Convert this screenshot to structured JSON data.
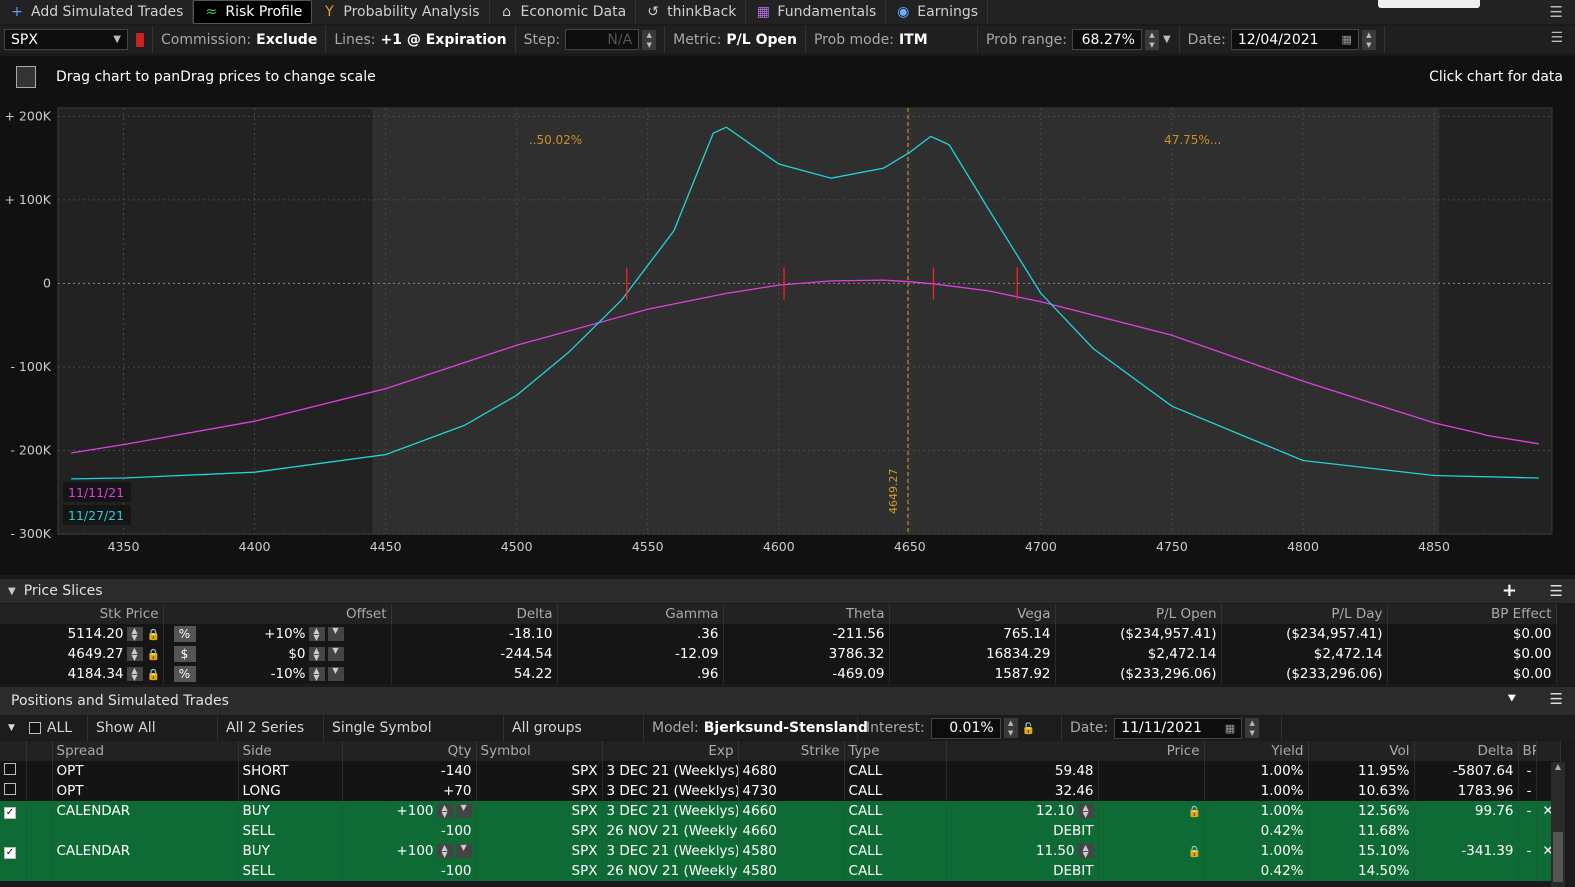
{
  "tabs": [
    {
      "icon": "plus-icon",
      "glyph": "+",
      "label": "Add Simulated Trades",
      "active": false
    },
    {
      "icon": "risk-profile-icon",
      "glyph": "≈",
      "label": "Risk Profile",
      "active": true
    },
    {
      "icon": "probability-icon",
      "glyph": "Y",
      "label": "Probability Analysis",
      "active": false
    },
    {
      "icon": "economic-data-icon",
      "glyph": "⌂",
      "label": "Economic Data",
      "active": false
    },
    {
      "icon": "thinkback-icon",
      "glyph": "↺",
      "label": "thinkBack",
      "active": false
    },
    {
      "icon": "fundamentals-icon",
      "glyph": "▦",
      "label": "Fundamentals",
      "active": false
    },
    {
      "icon": "earnings-icon",
      "glyph": "◉",
      "label": "Earnings",
      "active": false
    }
  ],
  "controls": {
    "symbol": "SPX",
    "commission_label": "Commission:",
    "commission_value": "Exclude",
    "lines_label": "Lines:",
    "lines_value": "+1 @ Expiration",
    "step_label": "Step:",
    "step_value": "N/A",
    "metric_label": "Metric:",
    "metric_value": "P/L Open",
    "probmode_label": "Prob mode:",
    "probmode_value": "ITM",
    "probrange_label": "Prob range:",
    "probrange_value": "68.27%",
    "date_label": "Date:",
    "date_value": "12/04/2021"
  },
  "chart_header": {
    "hint": "Drag chart to panDrag prices to change scale",
    "click_hint": "Click chart for data"
  },
  "chart_data": {
    "type": "line",
    "xlim": [
      4325,
      4895
    ],
    "ylim": [
      -300000,
      210000
    ],
    "xticks": [
      "4350",
      "4400",
      "4450",
      "4500",
      "4550",
      "4600",
      "4650",
      "4700",
      "4750",
      "4800",
      "4850"
    ],
    "yticks": [
      "+ 200K",
      "+ 100K",
      "0",
      "- 100K",
      "- 200K",
      "- 300K"
    ],
    "prob_left_label": "..50.02%",
    "prob_right_label": "47.75%...",
    "current_price_label": "4649.27",
    "current_price": 4649.27,
    "shaded_range": [
      4445,
      4852
    ],
    "colors": {
      "series1": "#e040e0",
      "series2": "#22d3d8",
      "current": "#d4a020",
      "marker": "#ff2020"
    },
    "series": [
      {
        "name": "11/11/21",
        "x": [
          4330,
          4350,
          4400,
          4450,
          4500,
          4550,
          4580,
          4600,
          4620,
          4640,
          4650,
          4660,
          4680,
          4700,
          4750,
          4800,
          4850,
          4868,
          4870,
          4890
        ],
        "y": [
          -203000,
          -193000,
          -165000,
          -126000,
          -74000,
          -31000,
          -12000,
          -2000,
          3000,
          4000,
          2000,
          -1000,
          -9000,
          -22000,
          -62000,
          -117000,
          -167000,
          -180000,
          -182000,
          -192000
        ]
      },
      {
        "name": "11/27/21",
        "x": [
          4330,
          4350,
          4400,
          4450,
          4480,
          4500,
          4520,
          4540,
          4560,
          4575,
          4580,
          4600,
          4620,
          4640,
          4650,
          4658,
          4665,
          4680,
          4700,
          4720,
          4750,
          4800,
          4850,
          4890
        ],
        "y": [
          -234000,
          -233000,
          -226000,
          -205000,
          -170000,
          -134000,
          -82000,
          -20000,
          63000,
          180000,
          187000,
          143000,
          126000,
          138000,
          157000,
          176000,
          166000,
          89000,
          -12000,
          -78000,
          -147000,
          -212000,
          -230000,
          -233000
        ]
      }
    ],
    "markers_x": [
      4542,
      4602,
      4659,
      4691
    ]
  },
  "price_slices": {
    "title": "Price Slices",
    "headers": [
      "Stk Price",
      "Offset",
      "Delta",
      "Gamma",
      "Theta",
      "Vega",
      "P/L Open",
      "P/L Day",
      "BP Effect"
    ],
    "rows": [
      {
        "stk": "5114.20",
        "unit": "%",
        "offset": "+10%",
        "delta": "-18.10",
        "gamma": ".36",
        "theta": "-211.56",
        "vega": "765.14",
        "plopen": "($234,957.41)",
        "plday": "($234,957.41)",
        "bp": "$0.00"
      },
      {
        "stk": "4649.27",
        "unit": "$",
        "offset": "$0",
        "delta": "-244.54",
        "gamma": "-12.09",
        "theta": "3786.32",
        "vega": "16834.29",
        "plopen": "$2,472.14",
        "plday": "$2,472.14",
        "bp": "$0.00"
      },
      {
        "stk": "4184.34",
        "unit": "%",
        "offset": "-10%",
        "delta": "54.22",
        "gamma": ".96",
        "theta": "-469.09",
        "vega": "1587.92",
        "plopen": "($233,296.06)",
        "plday": "($233,296.06)",
        "bp": "$0.00"
      }
    ]
  },
  "positions": {
    "title": "Positions and Simulated Trades",
    "all_label": "ALL",
    "show": "Show All",
    "series": "All 2 Series",
    "symbol_mode": "Single Symbol",
    "groups": "All groups",
    "model_label": "Model:",
    "model_value": "Bjerksund-Stensland",
    "interest_label": "Interest:",
    "interest_value": "0.01%",
    "date_label": "Date:",
    "date_value": "11/11/2021",
    "headers": [
      "Spread",
      "Side",
      "Qty",
      "Symbol",
      "Exp",
      "Strike",
      "Type",
      "Price",
      "Yield",
      "Vol",
      "Delta",
      "BP Effect"
    ],
    "rows": [
      {
        "green": false,
        "check": true,
        "spread": "OPT",
        "side": "SHORT",
        "qty": "-140",
        "symbol": "SPX",
        "exp": "3 DEC 21 (Weeklys)",
        "strike": "4680",
        "type": "CALL",
        "price": "59.48",
        "yield": "1.00%",
        "vol": "11.95%",
        "delta": "-5807.64",
        "bp": "-"
      },
      {
        "green": false,
        "check": true,
        "spread": "OPT",
        "side": "LONG",
        "qty": "+70",
        "symbol": "SPX",
        "exp": "3 DEC 21 (Weeklys)",
        "strike": "4730",
        "type": "CALL",
        "price": "32.46",
        "yield": "1.00%",
        "vol": "10.63%",
        "delta": "1783.96",
        "bp": "-"
      },
      {
        "green": true,
        "check": true,
        "checked": true,
        "spread": "CALENDAR",
        "side": "BUY",
        "qty": "+100",
        "symbol": "SPX",
        "exp": "3 DEC 21 (Weeklys)",
        "strike": "4660",
        "type": "CALL",
        "price": "12.10",
        "yield": "1.00%",
        "vol": "12.56%",
        "delta": "99.76",
        "bp": "-"
      },
      {
        "green": true,
        "check": false,
        "spread": "",
        "side": "SELL",
        "qty": "-100",
        "symbol": "SPX",
        "exp": "26 NOV 21 (Weeklys)",
        "strike": "4660",
        "type": "CALL",
        "price": "DEBIT",
        "yield": "0.42%",
        "vol": "11.68%",
        "delta": "",
        "bp": ""
      },
      {
        "green": true,
        "check": true,
        "checked": true,
        "spread": "CALENDAR",
        "side": "BUY",
        "qty": "+100",
        "symbol": "SPX",
        "exp": "3 DEC 21 (Weeklys)",
        "strike": "4580",
        "type": "CALL",
        "price": "11.50",
        "yield": "1.00%",
        "vol": "15.10%",
        "delta": "-341.39",
        "bp": "-"
      },
      {
        "green": true,
        "check": false,
        "spread": "",
        "side": "SELL",
        "qty": "-100",
        "symbol": "SPX",
        "exp": "26 NOV 21 (Weeklys)",
        "strike": "4580",
        "type": "CALL",
        "price": "DEBIT",
        "yield": "0.42%",
        "vol": "14.50%",
        "delta": "",
        "bp": ""
      }
    ]
  }
}
